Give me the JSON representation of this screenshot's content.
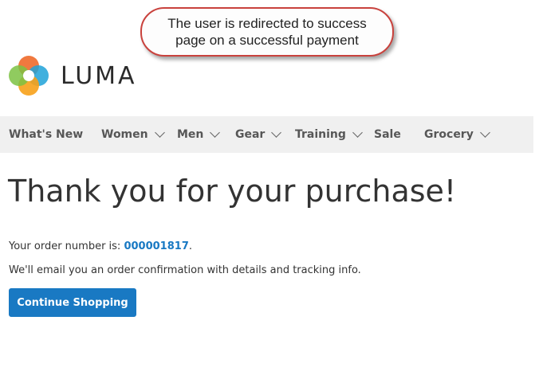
{
  "annotation": {
    "line1": "The user is redirected to success",
    "line2": "page on a successful payment"
  },
  "header": {
    "logo_text": "LUMA",
    "logo_icon": "luma-logo-icon"
  },
  "nav": {
    "items": [
      {
        "label": "What's New",
        "has_dropdown": false
      },
      {
        "label": "Women",
        "has_dropdown": true
      },
      {
        "label": "Men",
        "has_dropdown": true
      },
      {
        "label": "Gear",
        "has_dropdown": true
      },
      {
        "label": "Training",
        "has_dropdown": true
      },
      {
        "label": "Sale",
        "has_dropdown": false
      },
      {
        "label": "Grocery",
        "has_dropdown": true
      }
    ]
  },
  "main": {
    "title": "Thank you for your purchase!",
    "order_prefix": "Your order number is: ",
    "order_number": "000001817",
    "order_suffix": ".",
    "email_text": "We'll email you an order confirmation with details and tracking info.",
    "continue_label": "Continue Shopping"
  },
  "colors": {
    "accent": "#1979c3",
    "nav_bg": "#f0f0f0",
    "callout_border": "#c9423d"
  }
}
